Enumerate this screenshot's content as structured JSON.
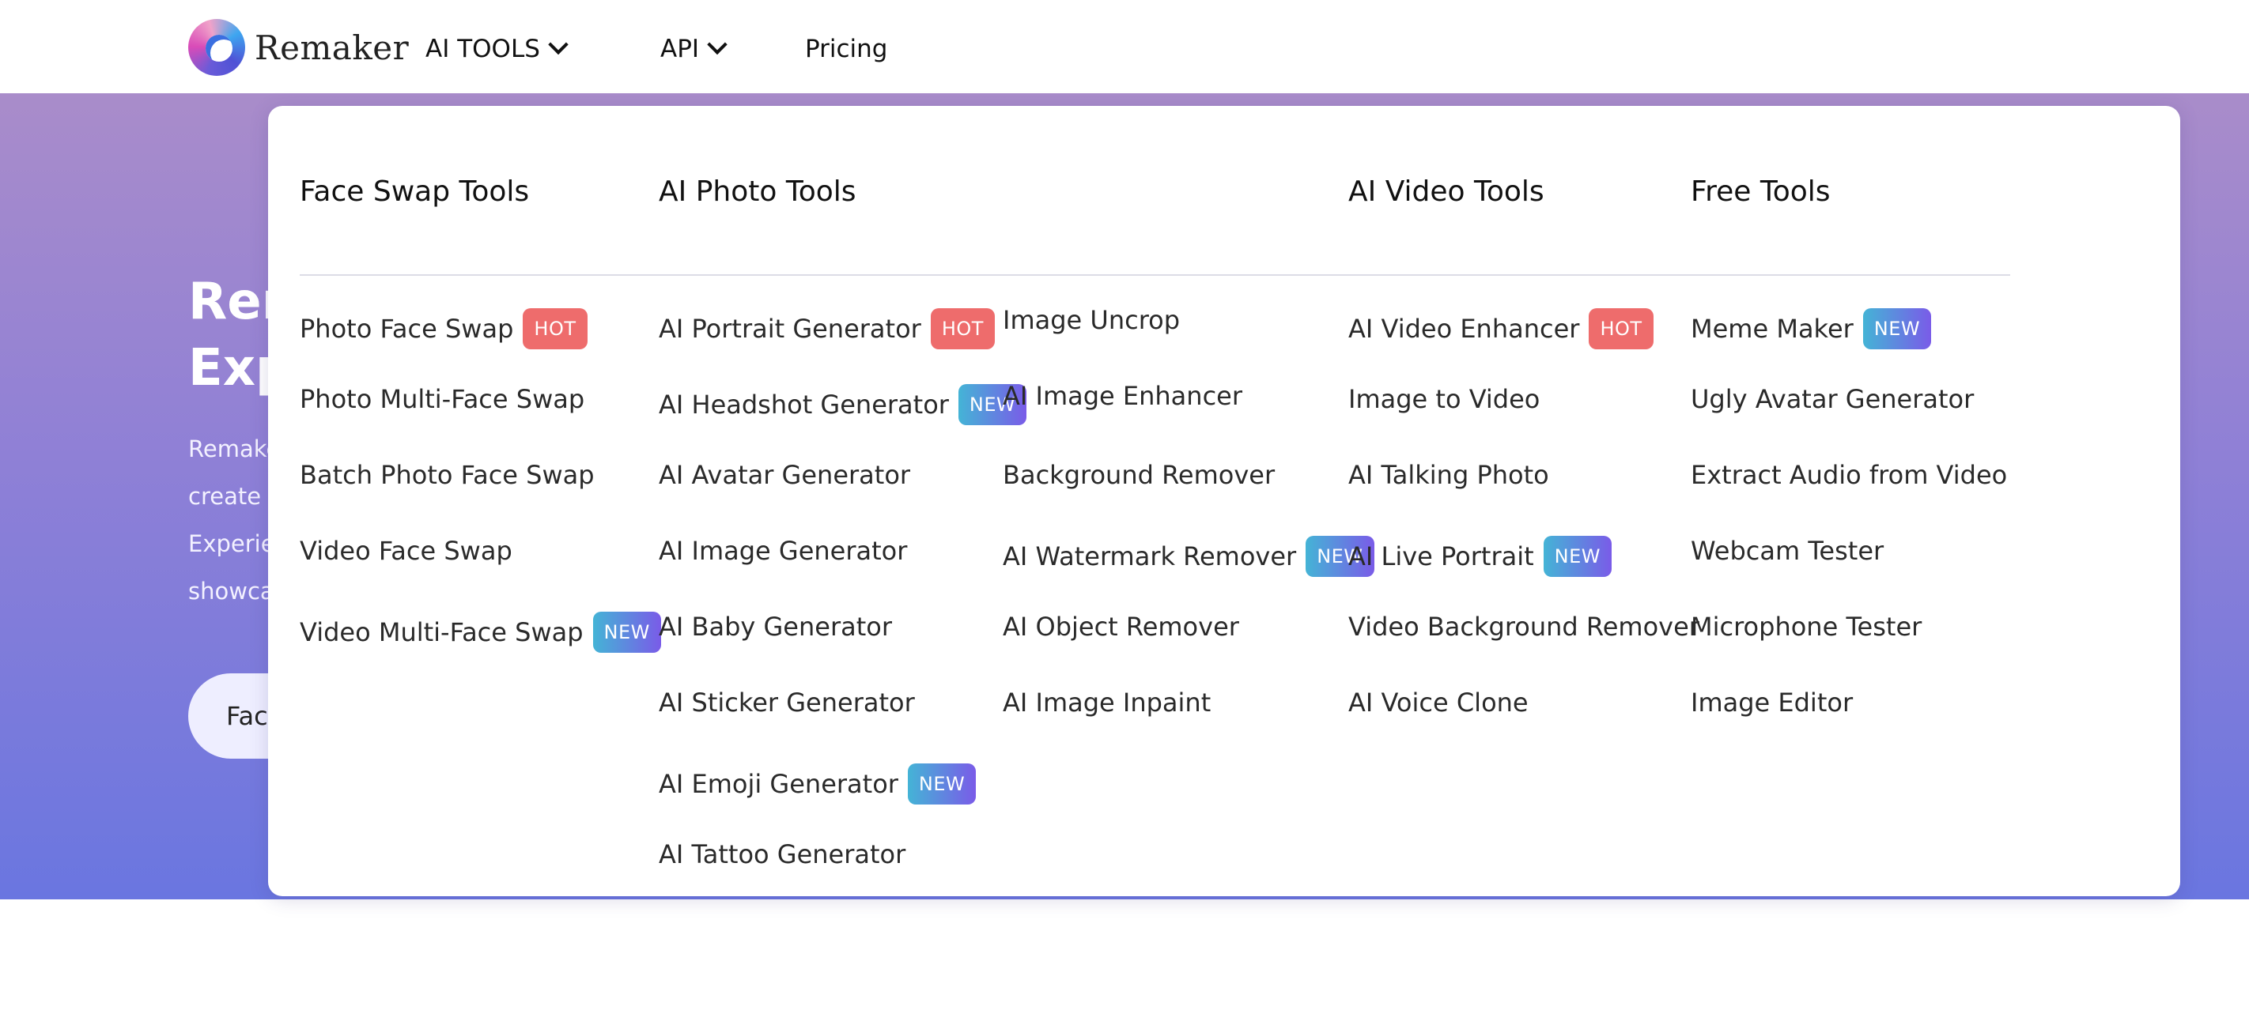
{
  "header": {
    "logo_text": "Remaker",
    "nav": {
      "ai_tools": "AI TOOLS",
      "api": "API",
      "pricing": "Pricing"
    }
  },
  "hero": {
    "title_line1": "Rem",
    "title_line2": "Exp",
    "desc_lines": [
      "Remake",
      "create",
      "Experie",
      "showca"
    ],
    "button_label": "Fac"
  },
  "menu": {
    "face_swap": {
      "heading": "Face Swap Tools",
      "items": [
        {
          "label": "Photo Face Swap",
          "badge": "HOT"
        },
        {
          "label": "Photo Multi-Face Swap",
          "badge": ""
        },
        {
          "label": "Batch Photo Face Swap",
          "badge": ""
        },
        {
          "label": "Video Face Swap",
          "badge": ""
        },
        {
          "label": "Video Multi-Face Swap",
          "badge": "NEW"
        }
      ]
    },
    "photo": {
      "heading": "AI Photo Tools",
      "items_a": [
        {
          "label": "AI Portrait Generator",
          "badge": "HOT"
        },
        {
          "label": "AI Headshot Generator",
          "badge": "NEW"
        },
        {
          "label": "AI Avatar Generator",
          "badge": ""
        },
        {
          "label": "AI Image Generator",
          "badge": ""
        },
        {
          "label": "AI Baby Generator",
          "badge": ""
        },
        {
          "label": "AI Sticker Generator",
          "badge": ""
        },
        {
          "label": "AI Emoji Generator",
          "badge": "NEW"
        },
        {
          "label": "AI Tattoo Generator",
          "badge": ""
        }
      ],
      "items_b": [
        {
          "label": "Image Uncrop",
          "badge": ""
        },
        {
          "label": "AI Image Enhancer",
          "badge": ""
        },
        {
          "label": "Background Remover",
          "badge": ""
        },
        {
          "label": "AI Watermark Remover",
          "badge": "NEW"
        },
        {
          "label": "AI Object Remover",
          "badge": ""
        },
        {
          "label": "AI Image Inpaint",
          "badge": ""
        }
      ]
    },
    "video": {
      "heading": "AI Video Tools",
      "items": [
        {
          "label": "AI Video Enhancer",
          "badge": "HOT"
        },
        {
          "label": "Image to Video",
          "badge": ""
        },
        {
          "label": "AI Talking Photo",
          "badge": ""
        },
        {
          "label": "AI Live Portrait",
          "badge": "NEW"
        },
        {
          "label": "Video Background Remover",
          "badge": ""
        },
        {
          "label": "AI Voice Clone",
          "badge": ""
        }
      ]
    },
    "free": {
      "heading": "Free Tools",
      "items": [
        {
          "label": "Meme Maker",
          "badge": "NEW"
        },
        {
          "label": "Ugly Avatar Generator",
          "badge": ""
        },
        {
          "label": "Extract Audio from Video",
          "badge": ""
        },
        {
          "label": "Webcam Tester",
          "badge": ""
        },
        {
          "label": "Microphone Tester",
          "badge": ""
        },
        {
          "label": "Image Editor",
          "badge": ""
        }
      ]
    }
  },
  "colors": {
    "hot_badge": "#ee6c6c",
    "new_badge_start": "#44b4d6",
    "new_badge_end": "#7a5be8",
    "hero_top": "#a98cca",
    "hero_bottom": "#6a76e0"
  }
}
